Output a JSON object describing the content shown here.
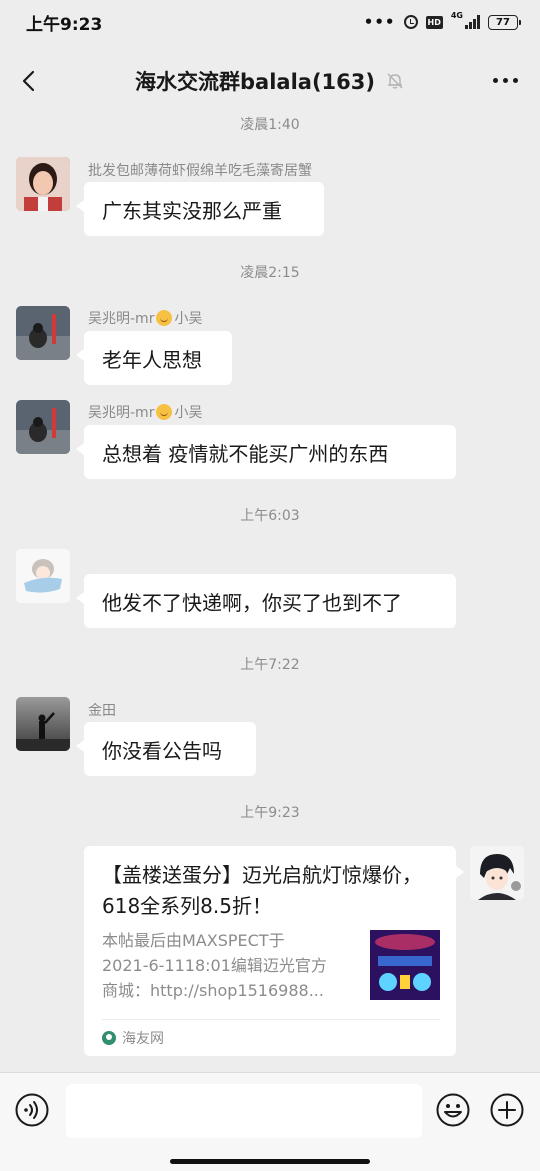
{
  "status_bar": {
    "time": "上午9:23",
    "dots": "•••",
    "hd": "HD",
    "network": "4G",
    "battery": "77"
  },
  "nav": {
    "title": "海水交流群balala(163)",
    "back_icon": "chevron-left-icon",
    "mute_icon": "bell-muted-icon",
    "more_icon": "more-dots-icon"
  },
  "messages": {
    "ts1": "凌晨1:40",
    "m1_sender": "批发包邮薄荷虾假绵羊吃毛藻寄居蟹",
    "m1_text": "广东其实没那么严重",
    "ts2": "凌晨2:15",
    "m2_sender_a": "吴兆明-mr",
    "m2_sender_b": "小吴",
    "m2_text": "老年人思想",
    "m3_sender_a": "吴兆明-mr",
    "m3_sender_b": "小吴",
    "m3_text": "总想着 疫情就不能买广州的东西",
    "ts3": "上午6:03",
    "m4_text": "他发不了快递啊，你买了也到不了",
    "ts4": "上午7:22",
    "m5_sender": "金田",
    "m5_text": "你没看公告吗",
    "ts5": "上午9:23"
  },
  "link_card": {
    "title": "【盖楼送蛋分】迈光启航灯惊爆价，618全系列8.5折！",
    "description": "本帖最后由MAXSPECT于\n2021-6-1118:01编辑迈光官方\n商城：http://shop1516988...",
    "source": "海友网",
    "source_icon": "haiyou-logo-icon"
  },
  "input_bar": {
    "voice_icon": "voice-icon",
    "emoji_icon": "emoji-icon",
    "plus_icon": "plus-icon",
    "input_value": ""
  },
  "colors": {
    "background": "#ededed",
    "bubble": "#ffffff",
    "timestamp": "#8c8c8c"
  }
}
